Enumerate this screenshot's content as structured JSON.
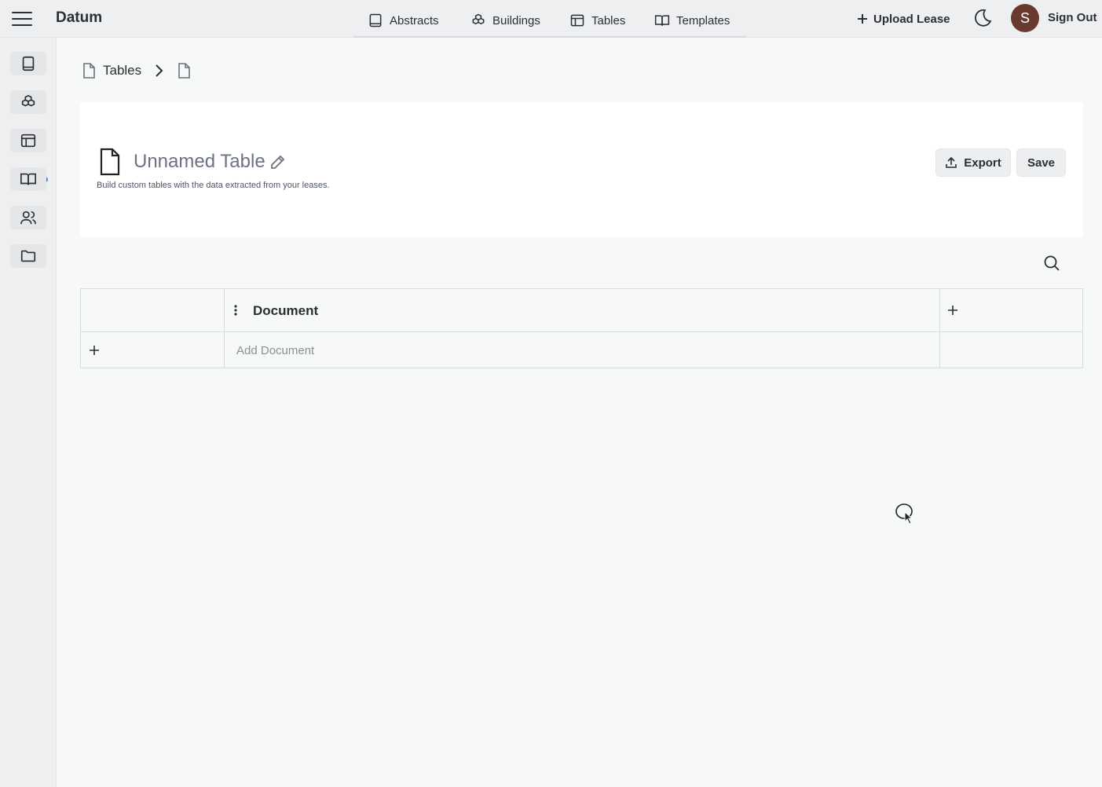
{
  "app": {
    "brand": "Datum"
  },
  "nav": {
    "items": [
      {
        "label": "Abstracts",
        "icon": "book-icon"
      },
      {
        "label": "Buildings",
        "icon": "cubes-icon"
      },
      {
        "label": "Tables",
        "icon": "table-icon"
      },
      {
        "label": "Templates",
        "icon": "open-book-icon"
      }
    ]
  },
  "header": {
    "upload_label": "Upload Lease",
    "avatar_initial": "S",
    "signout_label": "Sign Out"
  },
  "sidebar": {
    "items": [
      {
        "icon": "book-icon"
      },
      {
        "icon": "cubes-icon"
      },
      {
        "icon": "table-icon",
        "active": true
      },
      {
        "icon": "open-book-icon"
      },
      {
        "icon": "users-icon"
      },
      {
        "icon": "folder-icon"
      }
    ],
    "active_dot_color": "#3b82f6"
  },
  "breadcrumb": {
    "root_label": "Tables"
  },
  "page": {
    "title": "Unnamed Table",
    "subtitle": "Build custom tables with the data extracted from your leases.",
    "export_label": "Export",
    "save_label": "Save"
  },
  "table": {
    "columns": [
      "Document"
    ],
    "add_row_placeholder": "Add Document"
  },
  "colors": {
    "avatar_bg": "#6b3a2e",
    "accent": "#3b82f6"
  }
}
